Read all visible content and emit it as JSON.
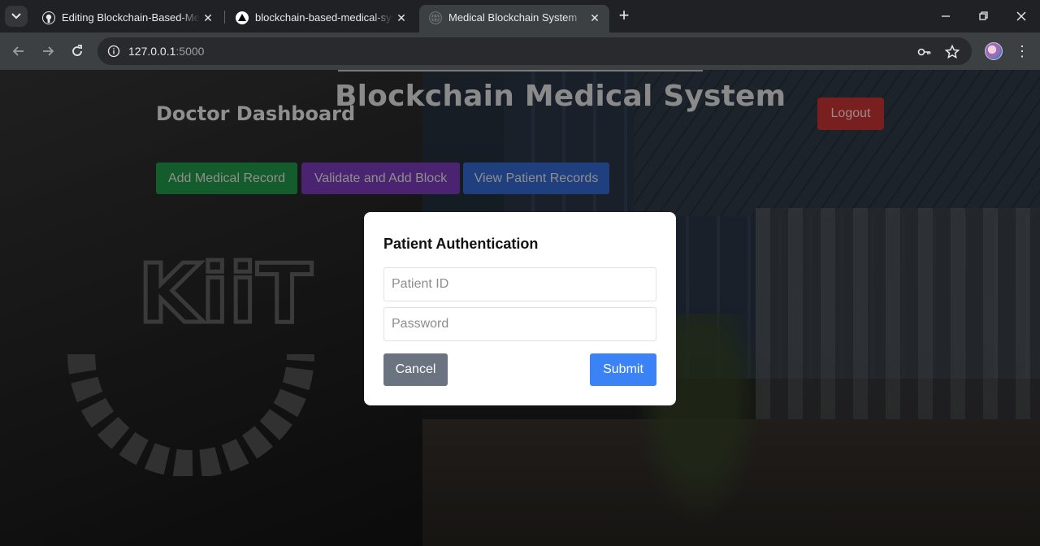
{
  "browser": {
    "tabs": [
      {
        "title": "Editing Blockchain-Based-Medi",
        "icon": "github-icon",
        "active": false
      },
      {
        "title": "blockchain-based-medical-syste",
        "icon": "vercel-icon",
        "active": false
      },
      {
        "title": "Medical Blockchain System",
        "icon": "globe-icon",
        "active": true
      }
    ],
    "url_host": "127.0.0.1",
    "url_port": ":5000"
  },
  "page": {
    "app_title": "Blockchain Medical System",
    "dashboard_title": "Doctor Dashboard",
    "logout_label": "Logout",
    "actions": {
      "add_record": "Add Medical Record",
      "validate_block": "Validate and Add Block",
      "view_records": "View Patient Records"
    },
    "background_logo_text": "KiiT"
  },
  "modal": {
    "title": "Patient Authentication",
    "patient_id_placeholder": "Patient ID",
    "password_placeholder": "Password",
    "cancel_label": "Cancel",
    "submit_label": "Submit"
  },
  "colors": {
    "submit": "#3b82f6",
    "cancel": "#6b7280",
    "add_record": "#16a34a",
    "validate": "#9333ea",
    "view_records": "#2563eb",
    "logout": "#dc2626"
  }
}
